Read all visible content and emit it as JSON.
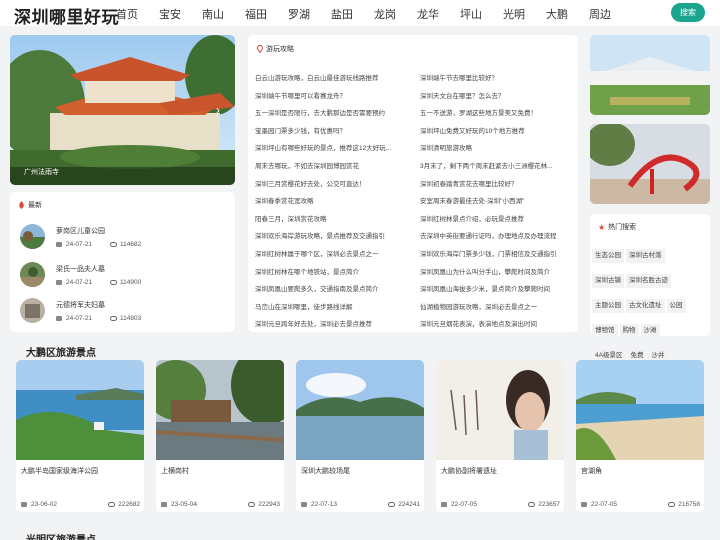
{
  "header": {
    "site_title": "深圳哪里好玩",
    "search_label": "搜索",
    "nav": [
      "首页",
      "宝安",
      "南山",
      "福田",
      "罗湖",
      "盐田",
      "龙岗",
      "龙华",
      "坪山",
      "光明",
      "大鹏",
      "周边"
    ]
  },
  "hero": {
    "caption": "广州法雨寺"
  },
  "guides": {
    "title": "游玩攻略",
    "left": [
      "白云山游玩攻略，白云山最佳游玩线路推荐",
      "深圳端午节哪里可以看赛龙舟？",
      "五一深圳是否限行，去大鹏那边是否需要预约",
      "宝墨园门票多少钱，有优惠吗？",
      "深圳坪山有哪些好玩的景点，推荐这12大好玩...",
      "周末去哪玩，不如去深圳园博园赏花",
      "深圳三月赏樱花好去处，公交可直达！",
      "深圳春季赏花宽攻略",
      "阳春三月，深圳赏花攻略",
      "深圳欢乐海岸游玩攻略，景点推荐及交通指引",
      "深圳红树林属于哪个区，深圳必去景点之一",
      "深圳红树林在哪个地铁站，景点简介",
      "深圳凤凰山要爬多久，交通指南及景点简介",
      "马峦山在深圳哪里，徒步路线详解",
      "深圳元旦跨年好去处，深圳必去景点推荐"
    ],
    "right": [
      "深圳端午节去哪里比较好？",
      "深圳天文台在哪里？怎么去？",
      "五一不送游，罗湖这些地方景美又免费！",
      "深圳坪山免费又好玩的10个地方推荐",
      "深圳清明旅游攻略",
      "3月末了，剩下两个周末赶紧去小三洲樱花林...",
      "深圳初春踏青赏花去哪里比较好？",
      "安室周末春游最佳去处-深圳\"小西湖\"",
      "深圳红树林景点介绍，必玩景点推荐",
      "去深圳中英街要通行证吗，办理地点及办理流程",
      "深圳欢乐海岸门票多少钱，门票相信及交通指引",
      "深圳凤凰山为什么叫分手山，攀爬时间及简介",
      "深圳凤凰山海拔多少米，景点简介及攀爬时间",
      "仙湖植物园游玩攻略，深圳必去景点之一",
      "深圳元旦烟花表演，表演地点及演出时间"
    ]
  },
  "latest": {
    "title": "最新",
    "items": [
      {
        "title": "萝岗区儿童公园",
        "date": "24-07-21",
        "views": "114682"
      },
      {
        "title": "梁氏一品夫人墓",
        "date": "24-07-21",
        "views": "114900"
      },
      {
        "title": "元德将军夫妇墓",
        "date": "24-07-21",
        "views": "114803"
      }
    ]
  },
  "hot_tags": {
    "title": "热门搜索",
    "tags": [
      "生态公园",
      "深圳古村落",
      "深圳古镇",
      "深圳名胜古迹",
      "主题公园",
      "古文化遗址",
      "公园",
      "博物馆",
      "购物",
      "沙滩",
      "4A级景区",
      "免费",
      "沙井"
    ]
  },
  "dapeng": {
    "title": "大鹏区旅游景点",
    "items": [
      {
        "title": "大鹏半岛国家级海洋公园",
        "date": "23-06-02",
        "views": "222682"
      },
      {
        "title": "上横岗村",
        "date": "23-05-04",
        "views": "222943"
      },
      {
        "title": "深圳大鹏较场尾",
        "date": "22-07-13",
        "views": "224241"
      },
      {
        "title": "大鹏协副将署遗址",
        "date": "22-07-05",
        "views": "223657"
      },
      {
        "title": "官湖角",
        "date": "22-07-05",
        "views": "216758"
      }
    ]
  },
  "guangming": {
    "title": "光明区旅游景点"
  },
  "colors": {
    "accent": "#1aa58c",
    "fire": "#e0453a"
  }
}
